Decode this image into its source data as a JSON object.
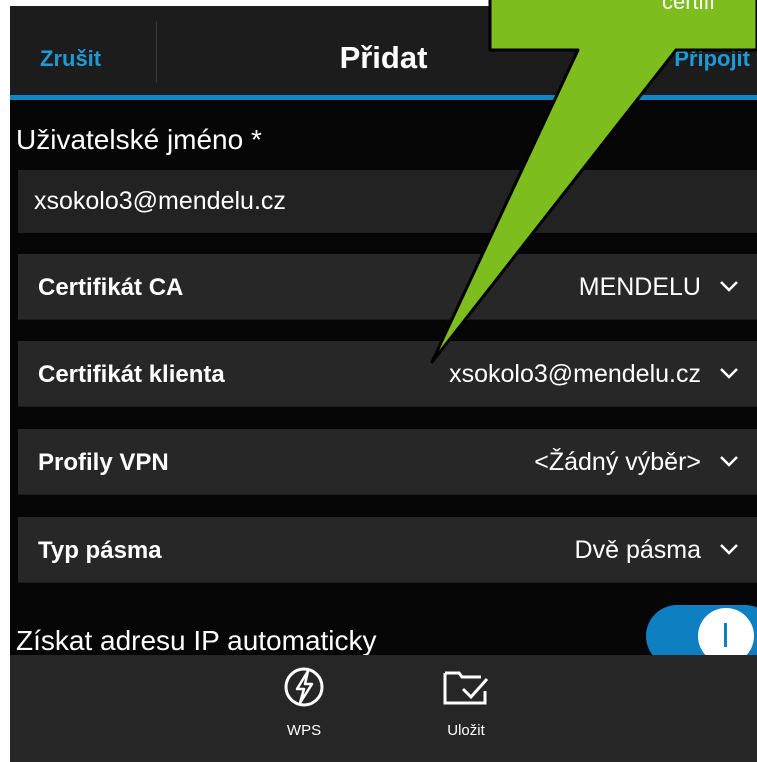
{
  "header": {
    "cancel_label": "Zrušit",
    "title": "Přidat",
    "connect_label": "Připojit"
  },
  "username": {
    "label": "Uživatelské jméno *",
    "value": "xsokolo3@mendelu.cz"
  },
  "settings": [
    {
      "label": "Certifikát CA",
      "value": "MENDELU"
    },
    {
      "label": "Certifikát klienta",
      "value": "xsokolo3@mendelu.cz"
    },
    {
      "label": "Profily VPN",
      "value": "<Žádný výběr>"
    },
    {
      "label": "Typ pásma",
      "value": "Dvě pásma"
    }
  ],
  "ip_auto": {
    "label": "Získat adresu IP automaticky",
    "state": "on"
  },
  "actions": [
    {
      "label": "WPS",
      "icon": "wps-icon"
    },
    {
      "label": "Uložit",
      "icon": "save-icon"
    }
  ],
  "callout": {
    "text": "certifi",
    "color": "#7dbd1e"
  },
  "colors": {
    "accent": "#1e9ad6",
    "background": "#060606",
    "row": "#272727"
  }
}
